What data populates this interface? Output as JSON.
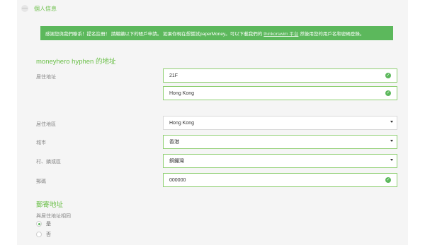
{
  "section": {
    "collapse_symbol": "—",
    "title": "個人信息"
  },
  "alert": {
    "text_before": "感謝您與我們聯系！提名註冊！ 請繼續以下的賬戶申請。 如果你現在想嘗試paperMoney。可以下載我們的",
    "link_text": "thinkorswim 平台",
    "text_after": "然後用您的用戶名和密碼登錄。"
  },
  "residential": {
    "heading": "moneyhero hyphen 的地址",
    "address_label": "居住地址",
    "address_line1": "21F",
    "address_line2": "Hong Kong",
    "region_label": "居住地區",
    "region_value": "Hong Kong",
    "city_label": "城市",
    "city_value": "香港",
    "district_label": "村、鎮或區",
    "district_value": "銅鑼灣",
    "postal_label": "郵碼",
    "postal_value": "000000"
  },
  "mailing": {
    "heading": "郵寄地址",
    "same_label": "與居住地址相同",
    "options": [
      {
        "label": "是",
        "selected": true
      },
      {
        "label": "否",
        "selected": false
      }
    ]
  },
  "colors": {
    "accent": "#6cc04a",
    "alert_bg": "#5cb85c",
    "valid_border": "#8fcf72"
  }
}
